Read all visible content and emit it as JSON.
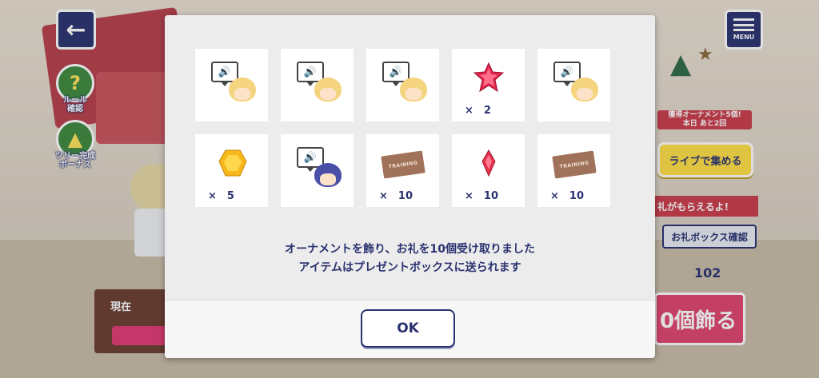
{
  "background": {
    "rules_label": "ルール\n確認",
    "tree_bonus_label": "ツリー完成\nボーナス",
    "menu_label": "MENU",
    "now_label": "現在",
    "ornament_info": "獲得オーナメント5個!\n本日 あと2回",
    "collect_button": "ライブで集める",
    "reward_banner": "礼がもらえるよ!",
    "box_button": "お礼ボックス確認",
    "count_value": "102",
    "decorate_button": "0個飾る"
  },
  "modal": {
    "items": [
      {
        "kind": "voice",
        "face": "blonde-glasses",
        "qty": ""
      },
      {
        "kind": "voice",
        "face": "blonde",
        "qty": ""
      },
      {
        "kind": "voice",
        "face": "blonde",
        "qty": ""
      },
      {
        "kind": "star-gem",
        "qty": "×　2"
      },
      {
        "kind": "voice",
        "face": "blonde",
        "qty": ""
      },
      {
        "kind": "yellow-gem",
        "qty": "×　5"
      },
      {
        "kind": "voice",
        "face": "navy",
        "qty": ""
      },
      {
        "kind": "training-ticket",
        "label": "TRAINING",
        "qty": "×　10"
      },
      {
        "kind": "red-crystal",
        "qty": "×　10"
      },
      {
        "kind": "training-ticket",
        "label": "TRAINING",
        "qty": "×　10"
      }
    ],
    "message_line1": "オーナメントを飾り、お礼を10個受け取りました",
    "message_line2": "アイテムはプレゼントボックスに送られます",
    "ok_label": "OK"
  },
  "colors": {
    "navy": "#2a3270",
    "accent_pink": "#e0446e",
    "accent_yellow": "#ffe046"
  }
}
